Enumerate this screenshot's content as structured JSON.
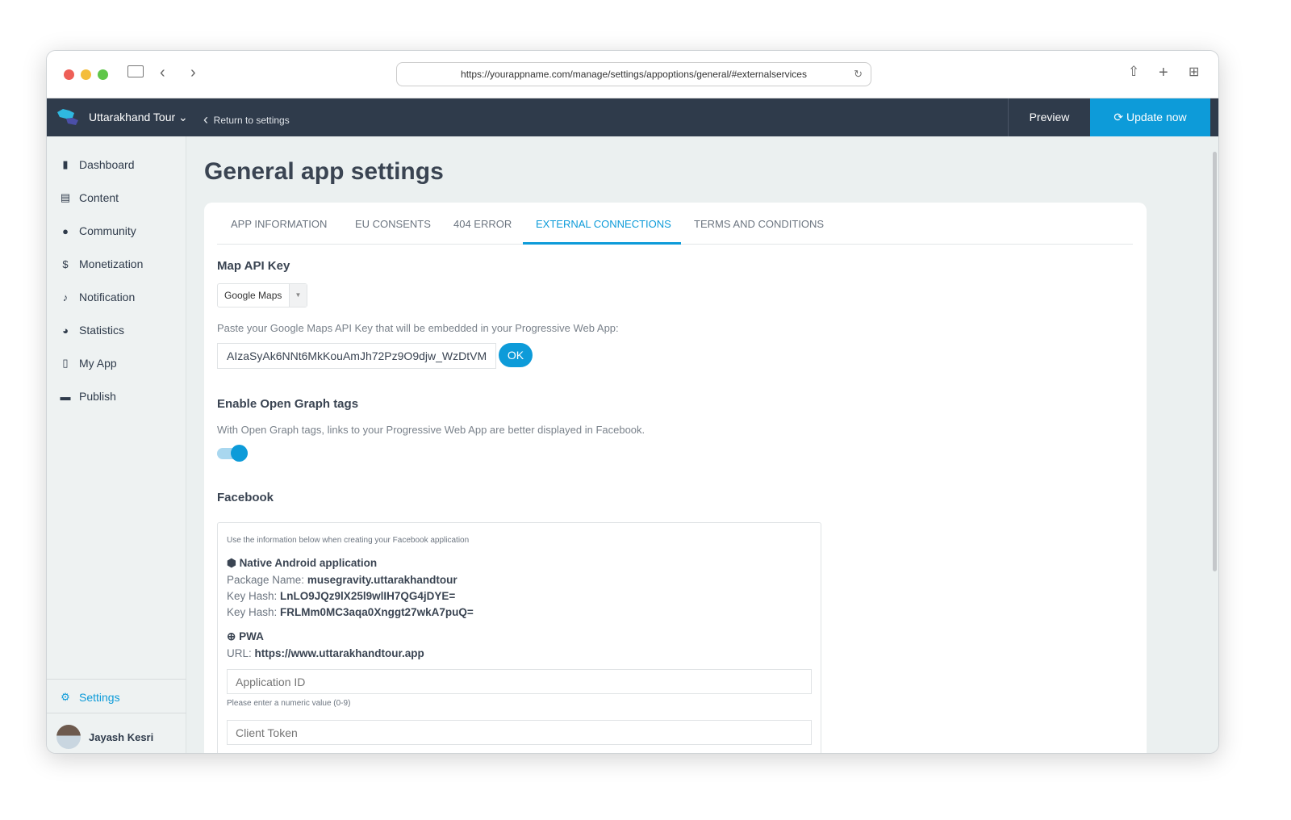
{
  "browser": {
    "url": "https://yourappname.com/manage/settings/appoptions/general/#externalservices"
  },
  "header": {
    "app_name": "Uttarakhand Tour",
    "return_label": "Return to settings",
    "preview_label": "Preview",
    "update_label": "Update now"
  },
  "sidebar": {
    "items": [
      {
        "label": "Dashboard",
        "icon": "bar-chart-icon"
      },
      {
        "label": "Content",
        "icon": "document-icon"
      },
      {
        "label": "Community",
        "icon": "user-icon"
      },
      {
        "label": "Monetization",
        "icon": "dollar-icon"
      },
      {
        "label": "Notification",
        "icon": "bell-icon"
      },
      {
        "label": "Statistics",
        "icon": "pie-chart-icon"
      },
      {
        "label": "My App",
        "icon": "phone-icon"
      },
      {
        "label": "Publish",
        "icon": "store-icon"
      }
    ],
    "settings_label": "Settings",
    "user_name": "Jayash Kesri"
  },
  "page": {
    "title": "General app settings",
    "tabs": [
      "APP INFORMATION",
      "EU CONSENTS",
      "404 ERROR",
      "EXTERNAL CONNECTIONS",
      "TERMS AND CONDITIONS"
    ],
    "map": {
      "heading": "Map API Key",
      "provider": "Google Maps",
      "help": "Paste your Google Maps API Key that will be embedded in your Progressive Web App:",
      "key_value": "AIzaSyAk6NNt6MkKouAmJh72Pz9O9djw_WzDtVM",
      "ok_label": "OK"
    },
    "og": {
      "heading": "Enable Open Graph tags",
      "help": "With Open Graph tags, links to your Progressive Web App are better displayed in Facebook.",
      "enabled": true
    },
    "facebook": {
      "heading": "Facebook",
      "intro": "Use the information below when creating your Facebook application",
      "android_heading": "Native Android application",
      "package_label": "Package Name:",
      "package_value": "musegravity.uttarakhandtour",
      "keyhash_label": "Key Hash:",
      "keyhash1": "LnLO9JQz9lX25l9wlIH7QG4jDYE=",
      "keyhash2": "FRLMm0MC3aqa0Xnggt27wkA7puQ=",
      "pwa_heading": "PWA",
      "url_label": "URL:",
      "url_value": "https://www.uttarakhandtour.app",
      "app_id_placeholder": "Application ID",
      "app_id_hint": "Please enter a numeric value (0-9)",
      "client_token_placeholder": "Client Token"
    }
  },
  "colors": {
    "accent": "#0d9bd9",
    "header_bg": "#2f3b4b"
  }
}
